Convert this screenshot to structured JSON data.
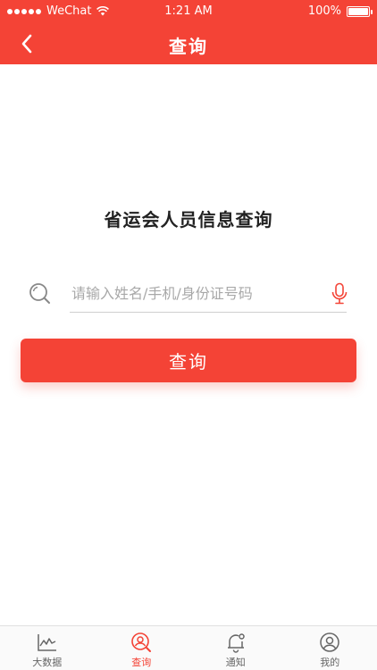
{
  "status_bar": {
    "carrier": "WeChat",
    "time": "1:21 AM",
    "battery": "100%"
  },
  "nav": {
    "title": "查询",
    "back_icon": "chevron-left-icon"
  },
  "main": {
    "title": "省运会人员信息查询",
    "search": {
      "placeholder": "请输入姓名/手机/身份证号码",
      "value": ""
    },
    "query_button_label": "查询"
  },
  "tab_bar": {
    "items": [
      {
        "label": "大数据",
        "icon": "chart-icon",
        "active": false
      },
      {
        "label": "查询",
        "icon": "search-user-icon",
        "active": true
      },
      {
        "label": "通知",
        "icon": "bell-icon",
        "active": false
      },
      {
        "label": "我的",
        "icon": "user-icon",
        "active": false
      }
    ]
  },
  "colors": {
    "accent": "#F44336",
    "inactive_tab": "#666666",
    "placeholder": "#A8A8A8"
  }
}
